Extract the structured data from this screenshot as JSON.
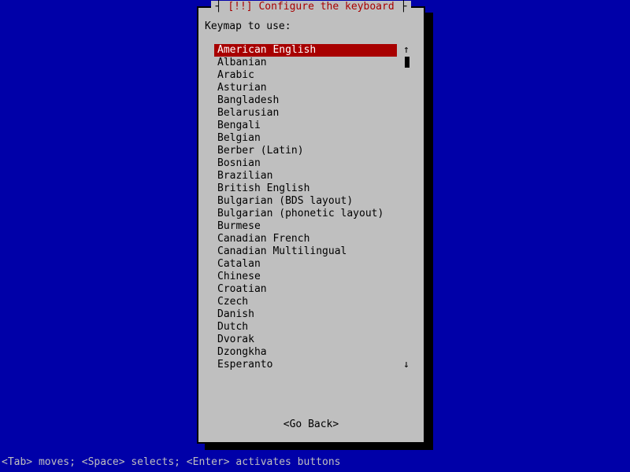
{
  "title": {
    "prefix": "┤ ",
    "bang": "[!!]",
    "text": " Configure the keyboard",
    "suffix": " ├"
  },
  "prompt": "Keymap to use:",
  "selected_index": 0,
  "items": [
    "American English",
    "Albanian",
    "Arabic",
    "Asturian",
    "Bangladesh",
    "Belarusian",
    "Bengali",
    "Belgian",
    "Berber (Latin)",
    "Bosnian",
    "Brazilian",
    "British English",
    "Bulgarian (BDS layout)",
    "Bulgarian (phonetic layout)",
    "Burmese",
    "Canadian French",
    "Canadian Multilingual",
    "Catalan",
    "Chinese",
    "Croatian",
    "Czech",
    "Danish",
    "Dutch",
    "Dvorak",
    "Dzongkha",
    "Esperanto"
  ],
  "go_back": "<Go Back>",
  "scroll": {
    "up": "↑",
    "down": "↓"
  },
  "hint": "<Tab> moves; <Space> selects; <Enter> activates buttons"
}
